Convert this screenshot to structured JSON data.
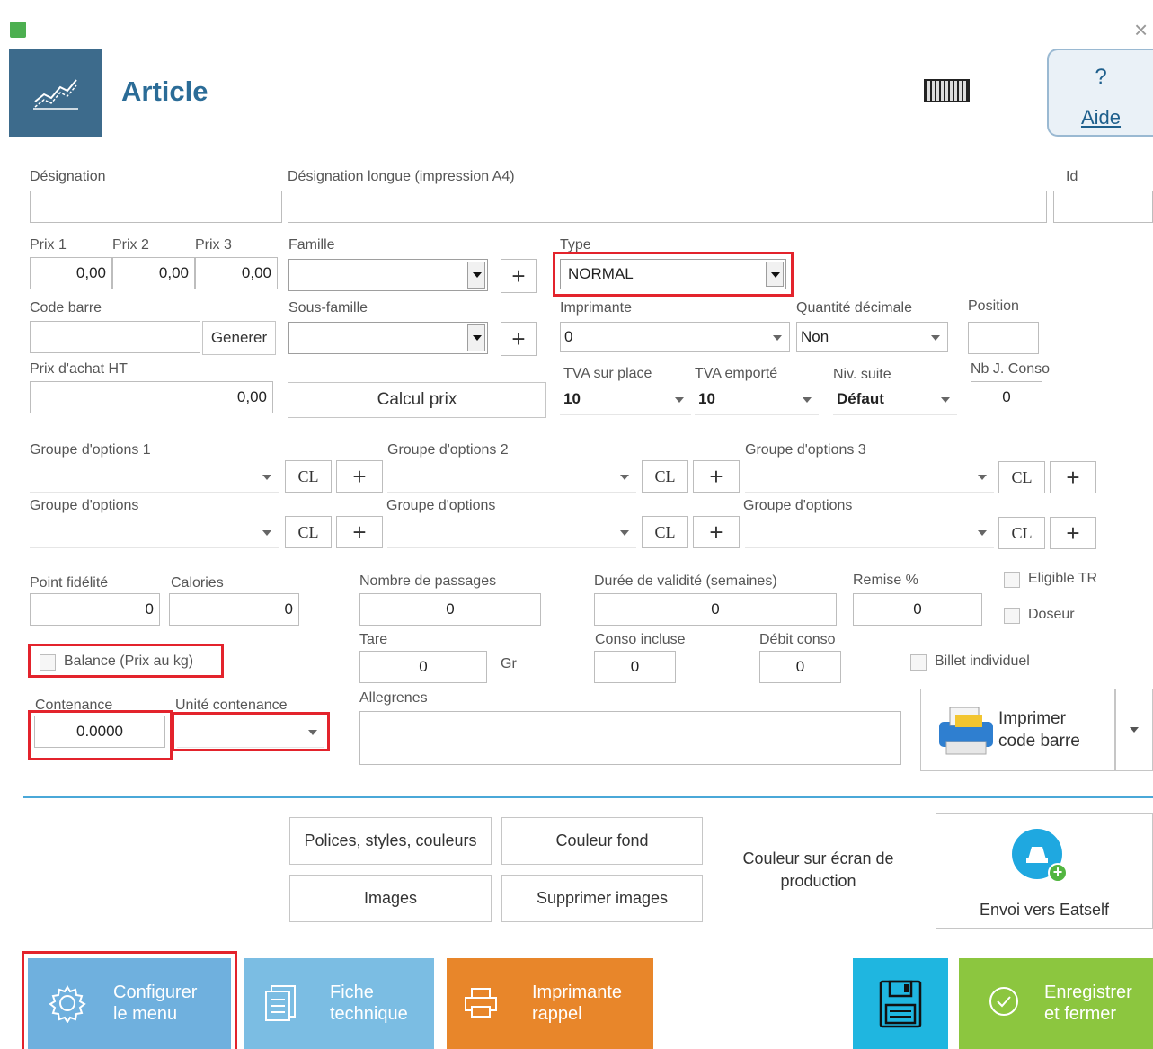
{
  "window": {
    "close_label": "×"
  },
  "header": {
    "title": "Article",
    "help_symbol": "?",
    "help_label": "Aide"
  },
  "labels": {
    "designation": "Désignation",
    "designation_longue": "Désignation longue (impression A4)",
    "id": "Id",
    "prix1": "Prix 1",
    "prix2": "Prix 2",
    "prix3": "Prix 3",
    "famille": "Famille",
    "type": "Type",
    "code_barre": "Code barre",
    "sous_famille": "Sous-famille",
    "imprimante": "Imprimante",
    "quantite_decimale": "Quantité décimale",
    "position": "Position",
    "prix_achat": "Prix d'achat HT",
    "tva_sur_place": "TVA sur place",
    "tva_emporte": "TVA emporté",
    "niv_suite": "Niv. suite",
    "nb_j_conso": "Nb J. Conso",
    "groupe1": "Groupe d'options 1",
    "groupe2": "Groupe d'options 2",
    "groupe3": "Groupe d'options 3",
    "groupe4": "Groupe d'options",
    "groupe5": "Groupe d'options",
    "groupe6": "Groupe d'options",
    "point_fidelite": "Point fidélité",
    "calories": "Calories",
    "nombre_passages": "Nombre de passages",
    "duree_validite": "Durée de validité (semaines)",
    "remise": "Remise %",
    "eligible_tr": "Eligible TR",
    "doseur": "Doseur",
    "tare": "Tare",
    "gr": "Gr",
    "conso_incluse": "Conso incluse",
    "debit_conso": "Débit conso",
    "billet_individuel": "Billet individuel",
    "balance": "Balance (Prix au kg)",
    "contenance": "Contenance",
    "unite_contenance": "Unité contenance",
    "allergenes": "Allegrenes"
  },
  "values": {
    "prix1": "0,00",
    "prix2": "0,00",
    "prix3": "0,00",
    "type": "NORMAL",
    "imprimante": "0",
    "quantite_decimale": "Non",
    "prix_achat": "0,00",
    "tva_sur_place": "10",
    "tva_emporte": "10",
    "niv_suite": "Défaut",
    "nb_j_conso": "0",
    "point_fidelite": "0",
    "calories": "0",
    "nombre_passages": "0",
    "duree_validite": "0",
    "remise": "0",
    "tare": "0",
    "conso_incluse": "0",
    "debit_conso": "0",
    "contenance": "0.0000"
  },
  "buttons": {
    "generer": "Generer",
    "calcul_prix": "Calcul prix",
    "cl": "CL",
    "plus": "+",
    "imprimer_code_barre_1": "Imprimer",
    "imprimer_code_barre_2": "code barre",
    "polices": "Polices, styles, couleurs",
    "couleur_fond": "Couleur fond",
    "images": "Images",
    "supprimer_images": "Supprimer images",
    "couleur_ecran_1": "Couleur sur écran de",
    "couleur_ecran_2": "production",
    "envoi_eatself": "Envoi vers Eatself",
    "configurer_1": "Configurer",
    "configurer_2": "le menu",
    "fiche_1": "Fiche",
    "fiche_2": "technique",
    "imprimante_rappel_1": "Imprimante",
    "imprimante_rappel_2": "rappel",
    "enregistrer_1": "Enregistrer",
    "enregistrer_2": "et fermer"
  },
  "colors": {
    "header_icon_bg": "#3d6b8c",
    "title": "#2b6c97",
    "configurer": "#6fb0de",
    "fiche": "#7bbde3",
    "imprimante": "#e8862a",
    "save": "#1fb6e0",
    "enregistrer": "#8cc63f",
    "highlight": "#e3232c"
  }
}
